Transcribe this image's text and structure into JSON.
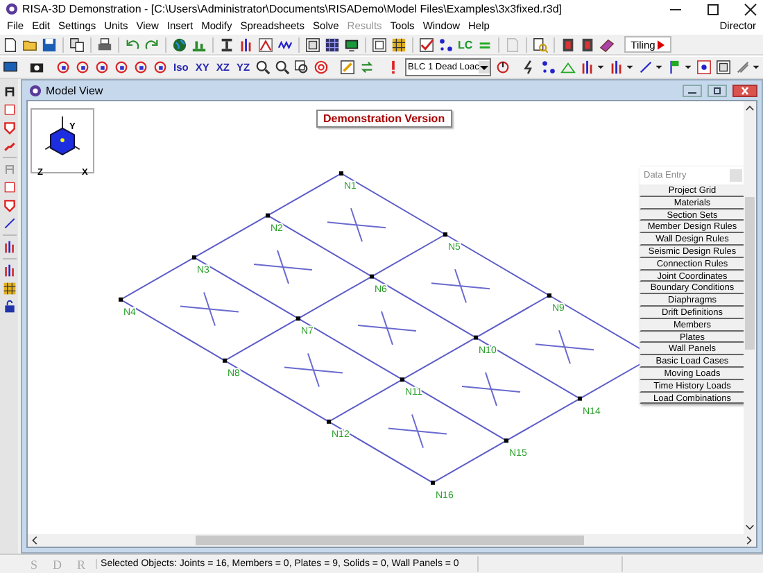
{
  "window": {
    "title": "RISA-3D Demonstration - [C:\\Users\\Administrator\\Documents\\RISADemo\\Model Files\\Examples\\3x3fixed.r3d]"
  },
  "menu": [
    {
      "label": "File",
      "disabled": false
    },
    {
      "label": "Edit",
      "disabled": false
    },
    {
      "label": "Settings",
      "disabled": false
    },
    {
      "label": "Units",
      "disabled": false
    },
    {
      "label": "View",
      "disabled": false
    },
    {
      "label": "Insert",
      "disabled": false
    },
    {
      "label": "Modify",
      "disabled": false
    },
    {
      "label": "Spreadsheets",
      "disabled": false
    },
    {
      "label": "Solve",
      "disabled": false
    },
    {
      "label": "Results",
      "disabled": true
    },
    {
      "label": "Tools",
      "disabled": false
    },
    {
      "label": "Window",
      "disabled": false
    },
    {
      "label": "Help",
      "disabled": false
    }
  ],
  "menu_right": "Director",
  "toolbar_1": {
    "lc": "LC",
    "tiling": "Tiling"
  },
  "toolbar_2": {
    "views": [
      "Iso",
      "XY",
      "XZ",
      "YZ"
    ],
    "load_case": "BLC 1 Dead Loac"
  },
  "model_view": {
    "title": "Model View",
    "banner": "Demonstration Version",
    "axes": [
      "Y",
      "Z",
      "X"
    ],
    "nodes": [
      "N1",
      "N2",
      "N3",
      "N4",
      "N5",
      "N6",
      "N7",
      "N8",
      "N9",
      "N10",
      "N11",
      "N12",
      "N14",
      "N15",
      "N16"
    ]
  },
  "data_entry": {
    "title": "Data Entry",
    "buttons": [
      "Project Grid",
      "Materials",
      "Section Sets",
      "Member Design Rules",
      "Wall Design Rules",
      "Seismic Design Rules",
      "Connection Rules",
      "Joint Coordinates",
      "Boundary Conditions",
      "Diaphragms",
      "Drift Definitions",
      "Members",
      "Plates",
      "Wall Panels",
      "Basic Load Cases",
      "Moving Loads",
      "Time History Loads",
      "Load Combinations"
    ]
  },
  "status_bar": {
    "modes": [
      "S",
      "D",
      "R"
    ],
    "selection": "Selected Objects:  Joints = 16,  Members = 0,  Plates = 9,  Solids = 0,  Wall Panels = 0"
  }
}
